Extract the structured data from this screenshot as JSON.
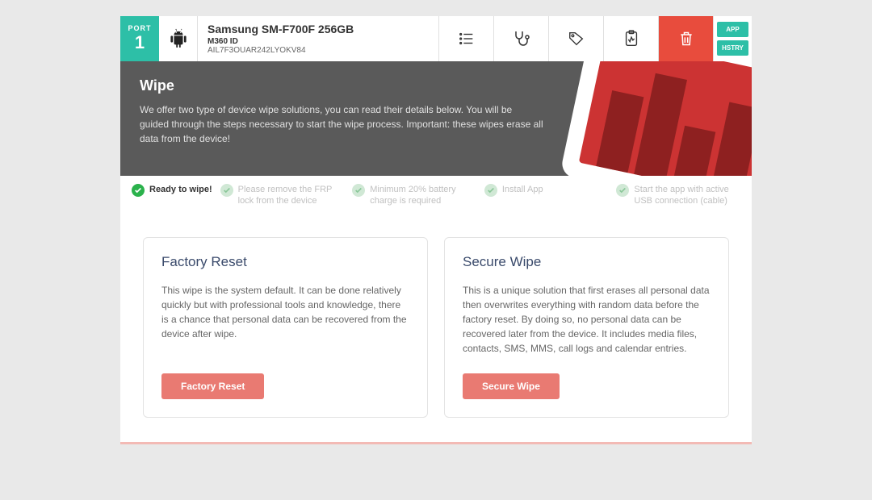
{
  "port": {
    "label": "PORT",
    "number": "1"
  },
  "device": {
    "name": "Samsung SM-F700F 256GB",
    "id_label": "M360 ID",
    "id_value": "AIL7F3OUAR242LYOKV84"
  },
  "side": {
    "app": "APP",
    "history": "HSTRY"
  },
  "hero": {
    "title": "Wipe",
    "body": "We offer two type of device wipe solutions, you can read their details below. You will be guided through the steps necessary to start the wipe process. Important: these wipes erase all data from the device!"
  },
  "steps": {
    "ready": "Ready to wipe!",
    "frp": "Please remove the FRP lock from the device",
    "battery": "Minimum 20% battery charge is required",
    "install": "Install App",
    "usb": "Start the app with active USB connection (cable)"
  },
  "cards": {
    "factory": {
      "title": "Factory Reset",
      "body": "This wipe is the system default. It can be done relatively quickly but with professional tools and knowledge, there is a chance that personal data can be recovered from the device after wipe.",
      "button": "Factory Reset"
    },
    "secure": {
      "title": "Secure Wipe",
      "body": "This is a unique solution that first erases all personal data then overwrites everything with random data before the factory reset. By doing so, no personal data can be recovered later from the device. It includes media files, contacts, SMS, MMS, call logs and calendar entries.",
      "button": "Secure Wipe"
    }
  }
}
